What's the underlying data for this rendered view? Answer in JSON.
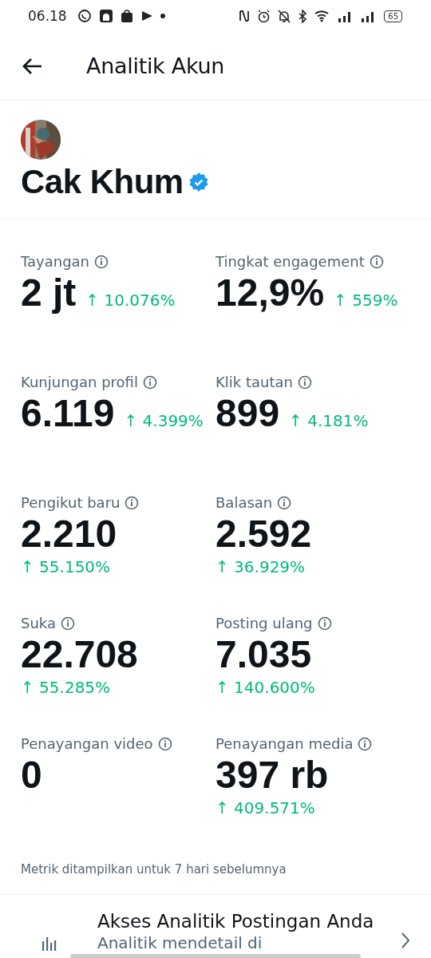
{
  "status_bar": {
    "time": "06.18",
    "battery": "65"
  },
  "header": {
    "title": "Analitik Akun"
  },
  "profile": {
    "name": "Cak Khum",
    "verified": true
  },
  "metrics": [
    {
      "label": "Tayangan",
      "value": "2 jt",
      "change": "↑ 10.076%"
    },
    {
      "label": "Tingkat engagement",
      "value": "12,9%",
      "change": "↑ 559%"
    },
    {
      "label": "Kunjungan profil",
      "value": "6.119",
      "change": "↑ 4.399%"
    },
    {
      "label": "Klik tautan",
      "value": "899",
      "change": "↑ 4.181%"
    },
    {
      "label": "Pengikut baru",
      "value": "2.210",
      "change": "↑ 55.150%"
    },
    {
      "label": "Balasan",
      "value": "2.592",
      "change": "↑ 36.929%"
    },
    {
      "label": "Suka",
      "value": "22.708",
      "change": "↑ 55.285%"
    },
    {
      "label": "Posting ulang",
      "value": "7.035",
      "change": "↑ 140.600%"
    },
    {
      "label": "Penayangan video",
      "value": "0"
    },
    {
      "label": "Penayangan media",
      "value": "397 rb",
      "change": "↑ 409.571%"
    }
  ],
  "footnote": "Metrik ditampilkan untuk 7 hari sebelumnya",
  "post_analytics": {
    "title": "Akses Analitik Postingan Anda",
    "subtitle": "Analitik mendetail di"
  }
}
